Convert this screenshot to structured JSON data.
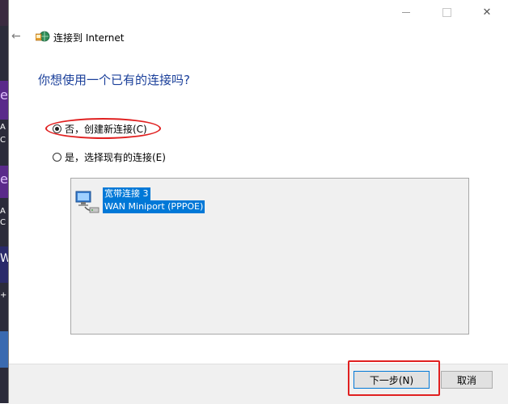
{
  "desktop": {
    "strip_labels": [
      "e",
      "A",
      "C",
      "e",
      "A",
      "C",
      "W",
      "+"
    ]
  },
  "window_controls": {
    "close_glyph": "✕"
  },
  "header": {
    "back_glyph": "←",
    "title": "连接到 Internet"
  },
  "question": "你想使用一个已有的连接吗?",
  "options": [
    {
      "label": "否，创建新连接(C)",
      "checked": true
    },
    {
      "label": "是，选择现有的连接(E)",
      "checked": false
    }
  ],
  "connection": {
    "name": "宽带连接 3",
    "device": "WAN Miniport (PPPOE)"
  },
  "buttons": {
    "next": "下一步(N)",
    "cancel": "取消"
  },
  "colors": {
    "accent": "#0078d7",
    "question_text": "#1a3f9a",
    "annotation_red": "#e02020"
  }
}
